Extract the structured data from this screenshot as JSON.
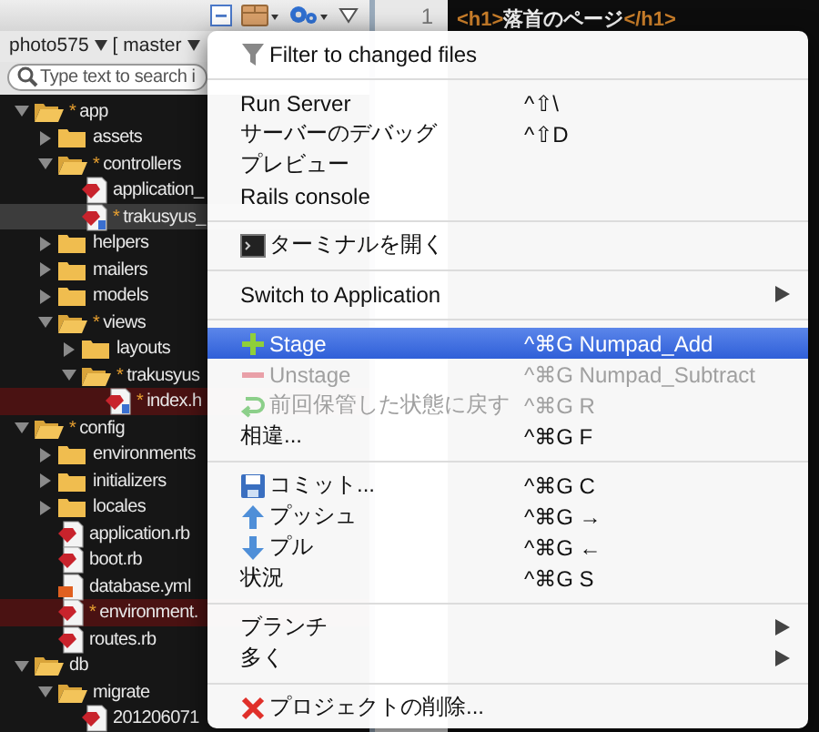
{
  "toolbar": {
    "project": "photo575",
    "branch": "[ master"
  },
  "search": {
    "placeholder": "Type text to search i"
  },
  "tree": [
    {
      "name": "app",
      "kind": "folder",
      "status": "*",
      "expanded": true,
      "selected": false,
      "highlighted": false,
      "children": [
        {
          "name": "assets",
          "kind": "folder",
          "expanded": false,
          "selected": false,
          "highlighted": false
        },
        {
          "name": "controllers",
          "kind": "folder",
          "status": "*",
          "expanded": true,
          "selected": false,
          "highlighted": false,
          "children": [
            {
              "name": "application_",
              "kind": "ruby",
              "selected": false,
              "highlighted": false
            },
            {
              "name": "trakusyus_",
              "kind": "ruby-changed",
              "status": "*",
              "selected": true,
              "highlighted": false
            }
          ]
        },
        {
          "name": "helpers",
          "kind": "folder",
          "expanded": false,
          "selected": false,
          "highlighted": false
        },
        {
          "name": "mailers",
          "kind": "folder",
          "expanded": false,
          "selected": false,
          "highlighted": false
        },
        {
          "name": "models",
          "kind": "folder",
          "expanded": false,
          "selected": false,
          "highlighted": false
        },
        {
          "name": "views",
          "kind": "folder",
          "status": "*",
          "expanded": true,
          "selected": false,
          "highlighted": false,
          "children": [
            {
              "name": "layouts",
              "kind": "folder",
              "expanded": false,
              "selected": false,
              "highlighted": false
            },
            {
              "name": "trakusyus",
              "kind": "folder",
              "status": "*",
              "expanded": true,
              "selected": false,
              "highlighted": false,
              "children": [
                {
                  "name": "index.h",
                  "kind": "ruby-changed",
                  "status": "*",
                  "selected": false,
                  "highlighted": true
                }
              ]
            }
          ]
        }
      ]
    },
    {
      "name": "config",
      "kind": "folder",
      "status": "*",
      "expanded": true,
      "selected": false,
      "highlighted": false,
      "children": [
        {
          "name": "environments",
          "kind": "folder",
          "expanded": false,
          "selected": false,
          "highlighted": false
        },
        {
          "name": "initializers",
          "kind": "folder",
          "expanded": false,
          "selected": false,
          "highlighted": false
        },
        {
          "name": "locales",
          "kind": "folder",
          "expanded": false,
          "selected": false,
          "highlighted": false
        },
        {
          "name": "application.rb",
          "kind": "ruby",
          "selected": false,
          "highlighted": false
        },
        {
          "name": "boot.rb",
          "kind": "ruby",
          "selected": false,
          "highlighted": false
        },
        {
          "name": "database.yml",
          "kind": "yaml",
          "selected": false,
          "highlighted": false
        },
        {
          "name": "environment.",
          "kind": "ruby",
          "status": "*",
          "selected": false,
          "highlighted": true
        },
        {
          "name": "routes.rb",
          "kind": "ruby",
          "selected": false,
          "highlighted": false
        }
      ]
    },
    {
      "name": "db",
      "kind": "folder",
      "expanded": true,
      "selected": false,
      "highlighted": false,
      "children": [
        {
          "name": "migrate",
          "kind": "folder",
          "expanded": true,
          "selected": false,
          "highlighted": false,
          "children": [
            {
              "name": "201206071",
              "kind": "ruby",
              "selected": false,
              "highlighted": false
            }
          ]
        }
      ]
    }
  ],
  "editor": {
    "line_number": "1",
    "tokens": [
      {
        "text": "<h1>",
        "kind": "tag"
      },
      {
        "text": "落首のページ",
        "kind": "text"
      },
      {
        "text": "</h1>",
        "kind": "tag"
      }
    ]
  },
  "menu": {
    "sections": [
      [
        {
          "label": "Filter to changed files",
          "kind": "filter",
          "selected": false,
          "disabled": false,
          "submenu": false
        }
      ],
      [
        {
          "label": "Run Server",
          "shortcut": "^⇧\\",
          "kind": "plain",
          "selected": false,
          "disabled": false,
          "submenu": false
        },
        {
          "label": "サーバーのデバッグ",
          "shortcut": "^⇧D",
          "kind": "plain",
          "selected": false,
          "disabled": false,
          "submenu": false
        },
        {
          "label": "プレビュー",
          "kind": "plain",
          "selected": false,
          "disabled": false,
          "submenu": false
        },
        {
          "label": "Rails console",
          "kind": "plain",
          "selected": false,
          "disabled": false,
          "submenu": false
        }
      ],
      [
        {
          "label": "ターミナルを開く",
          "kind": "terminal",
          "selected": false,
          "disabled": false,
          "submenu": false
        }
      ],
      [
        {
          "label": "Switch to Application",
          "kind": "plain",
          "selected": false,
          "disabled": false,
          "submenu": true
        }
      ],
      [
        {
          "label": "Stage",
          "shortcut": "^⌘G Numpad_Add",
          "kind": "plus",
          "selected": true,
          "disabled": false,
          "submenu": false
        },
        {
          "label": "Unstage",
          "shortcut": "^⌘G Numpad_Subtract",
          "kind": "minus",
          "selected": false,
          "disabled": true,
          "submenu": false
        },
        {
          "label": "前回保管した状態に戻す",
          "shortcut": "^⌘G R",
          "kind": "revert",
          "selected": false,
          "disabled": true,
          "submenu": false
        },
        {
          "label": "相違...",
          "shortcut": "^⌘G F",
          "kind": "plain",
          "selected": false,
          "disabled": false,
          "submenu": false
        }
      ],
      [
        {
          "label": "コミット...",
          "shortcut": "^⌘G C",
          "kind": "commit",
          "selected": false,
          "disabled": false,
          "submenu": false
        },
        {
          "label": "プッシュ",
          "shortcut": "^⌘G →",
          "kind": "push",
          "selected": false,
          "disabled": false,
          "submenu": false
        },
        {
          "label": "プル",
          "shortcut": "^⌘G ←",
          "kind": "pull",
          "selected": false,
          "disabled": false,
          "submenu": false
        },
        {
          "label": "状況",
          "shortcut": "^⌘G S",
          "kind": "plain",
          "selected": false,
          "disabled": false,
          "submenu": false
        }
      ],
      [
        {
          "label": "ブランチ",
          "kind": "plain",
          "selected": false,
          "disabled": false,
          "submenu": true
        },
        {
          "label": "多く",
          "kind": "plain",
          "selected": false,
          "disabled": false,
          "submenu": true
        }
      ],
      [
        {
          "label": "プロジェクトの削除...",
          "kind": "delete",
          "selected": false,
          "disabled": false,
          "submenu": false
        }
      ]
    ]
  }
}
